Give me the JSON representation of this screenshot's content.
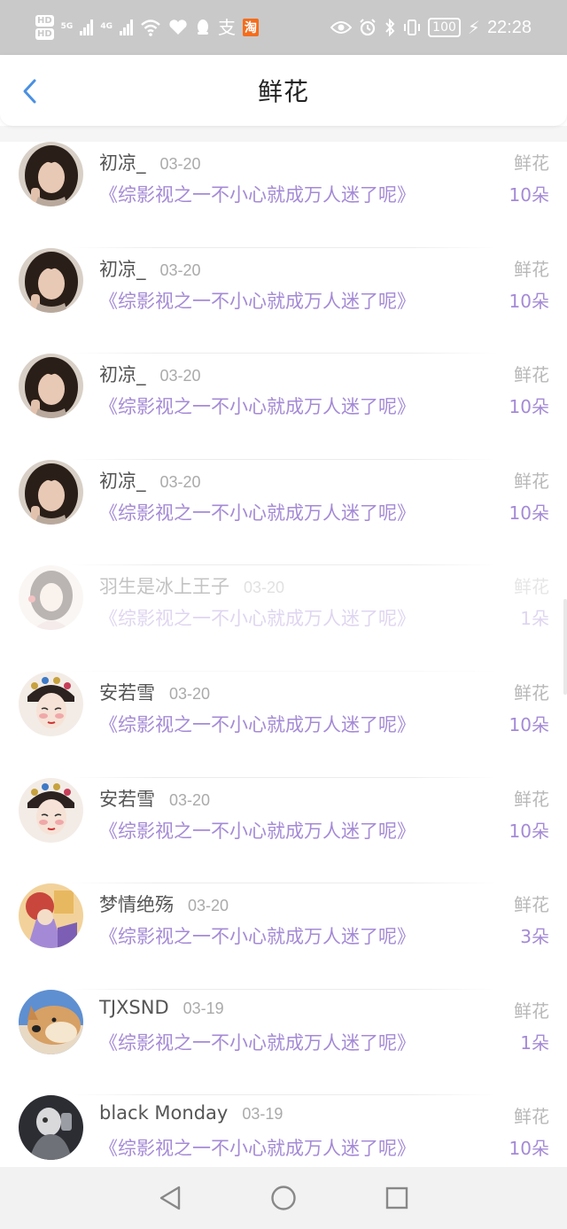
{
  "status_bar": {
    "hd1": "HD",
    "hd2": "HD",
    "net1": "5G",
    "net2": "4G",
    "alipay": "支",
    "taobao": "淘",
    "battery": "100",
    "time": "22:28"
  },
  "header": {
    "title": "鲜花"
  },
  "rows": [
    {
      "name": "初凉_",
      "date": "03-20",
      "book": "《综影视之一不小心就成万人迷了呢》",
      "type": "鲜花",
      "count": "10朵",
      "avatar": "girl-dark-hair",
      "faded": false
    },
    {
      "name": "初凉_",
      "date": "03-20",
      "book": "《综影视之一不小心就成万人迷了呢》",
      "type": "鲜花",
      "count": "10朵",
      "avatar": "girl-dark-hair",
      "faded": false
    },
    {
      "name": "初凉_",
      "date": "03-20",
      "book": "《综影视之一不小心就成万人迷了呢》",
      "type": "鲜花",
      "count": "10朵",
      "avatar": "girl-dark-hair",
      "faded": false
    },
    {
      "name": "初凉_",
      "date": "03-20",
      "book": "《综影视之一不小心就成万人迷了呢》",
      "type": "鲜花",
      "count": "10朵",
      "avatar": "girl-dark-hair",
      "faded": false
    },
    {
      "name": "羽生是冰上王子",
      "date": "03-20",
      "book": "《综影视之一不小心就成万人迷了呢》",
      "type": "鲜花",
      "count": "1朵",
      "avatar": "girl-portrait",
      "faded": true
    },
    {
      "name": "安若雪",
      "date": "03-20",
      "book": "《综影视之一不小心就成万人迷了呢》",
      "type": "鲜花",
      "count": "10朵",
      "avatar": "opera-girl",
      "faded": false
    },
    {
      "name": "安若雪",
      "date": "03-20",
      "book": "《综影视之一不小心就成万人迷了呢》",
      "type": "鲜花",
      "count": "10朵",
      "avatar": "opera-girl",
      "faded": false
    },
    {
      "name": "梦情绝殇",
      "date": "03-20",
      "book": "《综影视之一不小心就成万人迷了呢》",
      "type": "鲜花",
      "count": "3朵",
      "avatar": "anime-illustration",
      "faded": false
    },
    {
      "name": "TJXSND",
      "date": "03-19",
      "book": "《综影视之一不小心就成万人迷了呢》",
      "type": "鲜花",
      "count": "1朵",
      "avatar": "shiba-dog",
      "faded": false
    },
    {
      "name": "black Monday",
      "date": "03-19",
      "book": "《综影视之一不小心就成万人迷了呢》",
      "type": "鲜花",
      "count": "10朵",
      "avatar": "dark-figure",
      "faded": false
    }
  ],
  "nav": {
    "back": "back-triangle-icon",
    "home": "home-circle-icon",
    "recents": "recents-square-icon"
  }
}
